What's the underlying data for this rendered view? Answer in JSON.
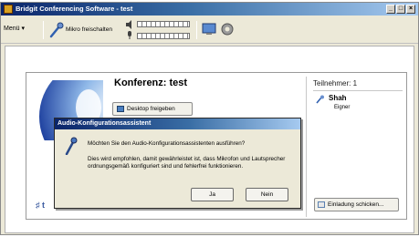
{
  "window": {
    "title": "Bridgit Conferencing Software - test",
    "controls": {
      "minimize": "_",
      "maximize": "□",
      "close": "×"
    }
  },
  "toolbar": {
    "menu_label": "Menü ▾",
    "mute_label": "Mikro freischalten",
    "icons": [
      "microphone-muted-icon",
      "speaker-icon",
      "microphone-icon",
      "desktop-share-icon",
      "settings-icon"
    ]
  },
  "conference": {
    "title": "Konferenz: test",
    "desktop_button": "Desktop freigeben",
    "participants_header": "Teilnehmer: 1",
    "participant": {
      "name": "Shah",
      "role": "Eigner"
    },
    "invite_button": "Einladung schicken...",
    "side_glyphs": "♯ t"
  },
  "dialog": {
    "title": "Audio-Konfigurationsassistent",
    "question": "Möchten Sie den Audio-Konfigurationsassistenten ausführen?",
    "info": "Dies wird empfohlen, damit gewährleistet ist, dass Mikrofon und Lautsprecher ordnungsgemäß konfiguriert sind und fehlerfrei funktionieren.",
    "yes_label": "Ja",
    "no_label": "Nein"
  },
  "colors": {
    "titlebar": "#0a246a",
    "window_bg": "#ece9d8",
    "accent_blue": "#3a6ea5"
  }
}
